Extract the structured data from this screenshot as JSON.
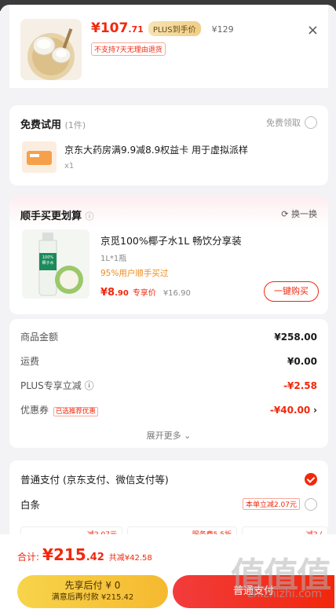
{
  "product": {
    "price_int": "¥107",
    "price_dec": ".71",
    "plus_tag": "PLUS到手价",
    "orig_price": "¥129",
    "no_return": "不支持7天无理由退货",
    "close": "×"
  },
  "free_trial": {
    "title": "免费试用",
    "count": "(1件)",
    "claim": "免费领取",
    "item_name": "京东大药房满9.9减8.9权益卡 用于虚拟派样",
    "item_qty": "x1"
  },
  "addon": {
    "title": "顺手买更划算",
    "info": "ⓘ",
    "refresh": "换一换",
    "item_name": "京觅100%椰子水1L 畅饮分享装",
    "spec": "1L*1瓶",
    "note": "95%用户顺手买过",
    "price_int": "¥8",
    "price_dec": ".90",
    "price_tag": "专享价",
    "orig_price": "¥16.90",
    "buy_button": "一键购买",
    "bottle_label": "100% 椰子水"
  },
  "summary": {
    "goods_label": "商品金额",
    "goods_value": "¥258.00",
    "shipping_label": "运费",
    "shipping_value": "¥0.00",
    "plus_label": "PLUS专享立减",
    "plus_value": "-¥2.58",
    "coupon_label": "优惠券",
    "coupon_tag": "已选推荐优惠",
    "coupon_value": "-¥40.00",
    "expand": "展开更多 ⌄"
  },
  "payment": {
    "normal_label": "普通支付 (京东支付、微信支付等)",
    "baitiao_label": "白条",
    "baitiao_tag": "本单立减2.07元",
    "peek_1": "减2.07元",
    "peek_2": "服务费5.5折",
    "peek_3": "减2.("
  },
  "bottom": {
    "total_label": "合计:",
    "total_int": "¥215",
    "total_dec": ".42",
    "total_save": "共减¥42.58",
    "first_btn": "先享后付 ¥ 0",
    "first_btn_sub": "满意后再付款 ¥215.42",
    "normal_btn": "普通支付"
  },
  "watermark": {
    "text": "值值值",
    "sub": "zhizhizhi.com"
  },
  "colors": {
    "accent": "#f2270c",
    "gold": "#f5c53a"
  }
}
